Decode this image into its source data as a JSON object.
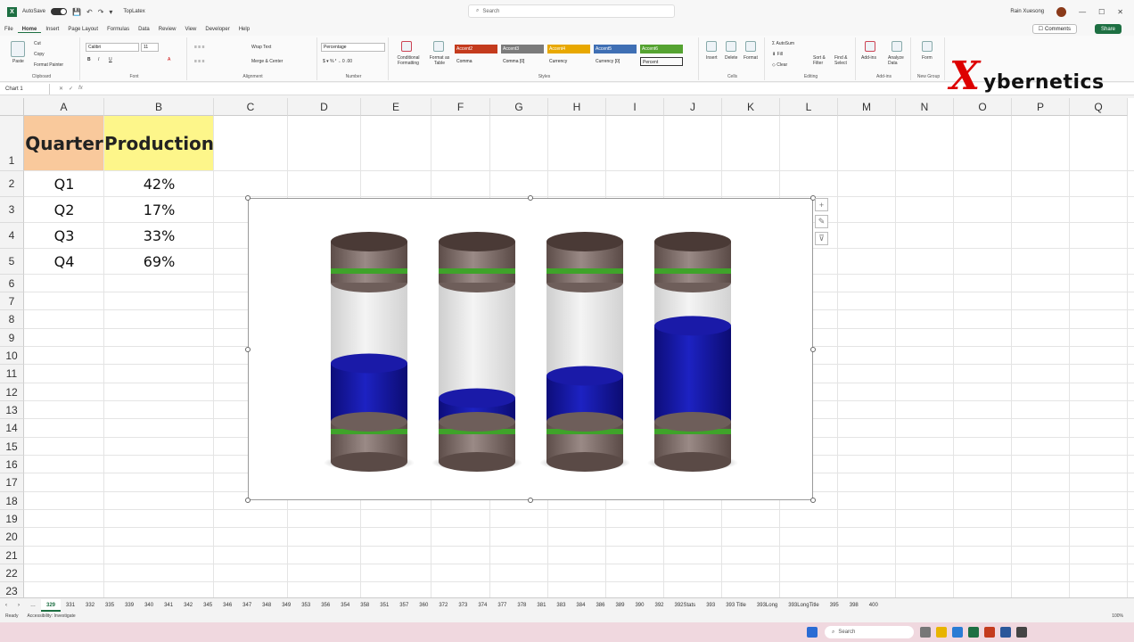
{
  "titlebar": {
    "autosave_label": "AutoSave",
    "file_name": "TopLatex",
    "search_placeholder": "Search",
    "user_name": "Rain Xuesong",
    "minimize": "—",
    "maximize": "☐",
    "close": "✕"
  },
  "menu": {
    "tabs": [
      "File",
      "Home",
      "Insert",
      "Page Layout",
      "Formulas",
      "Data",
      "Review",
      "View",
      "Developer",
      "Help"
    ],
    "active_tab": "Home",
    "comments_label": "Comments",
    "share_label": "Share"
  },
  "ribbon": {
    "clipboard": {
      "paste": "Paste",
      "cut": "Cut",
      "copy": "Copy",
      "format_painter": "Format Painter",
      "label": "Clipboard"
    },
    "font": {
      "font_name": "Calibri",
      "font_size": "11",
      "label": "Font"
    },
    "alignment": {
      "wrap_text": "Wrap Text",
      "merge_center": "Merge & Center",
      "label": "Alignment"
    },
    "number": {
      "format": "Percentage",
      "label": "Number"
    },
    "styles": {
      "conditional": "Conditional Formatting",
      "format_as_table": "Format as Table",
      "cells": [
        {
          "text": "Accent2",
          "color": "#c43b1d"
        },
        {
          "text": "Accent3",
          "color": "#7b7b7b"
        },
        {
          "text": "Accent4",
          "color": "#e8a800"
        },
        {
          "text": "Accent5",
          "color": "#3f6fb4"
        },
        {
          "text": "Accent6",
          "color": "#55a331"
        }
      ],
      "plain": [
        "Comma",
        "Comma [0]",
        "Currency",
        "Currency [0]",
        "Percent"
      ],
      "label": "Styles"
    },
    "cells": {
      "insert": "Insert",
      "delete": "Delete",
      "format": "Format",
      "label": "Cells"
    },
    "editing": {
      "autosum": "AutoSum",
      "fill": "Fill",
      "clear": "Clear",
      "sort_filter": "Sort & Filter",
      "find_select": "Find & Select",
      "label": "Editing"
    },
    "addins": {
      "addins": "Add-ins",
      "analyze": "Analyze Data",
      "label": "Add-ins"
    },
    "new_group": {
      "form": "Form",
      "label": "New Group"
    }
  },
  "formula_bar": {
    "name_box": "Chart 1",
    "fx": "fx",
    "content": ""
  },
  "columns": [
    "A",
    "B",
    "C",
    "D",
    "E",
    "F",
    "G",
    "H",
    "I",
    "J",
    "K",
    "L",
    "M",
    "N",
    "O",
    "P",
    "Q"
  ],
  "rows": [
    "1",
    "2",
    "3",
    "4",
    "5",
    "6",
    "7",
    "8",
    "9",
    "10",
    "11",
    "12",
    "13",
    "14",
    "15",
    "16",
    "17",
    "18",
    "19",
    "20",
    "21",
    "22",
    "23"
  ],
  "table": {
    "header_a": "Quarter",
    "header_b": "Production",
    "rows": [
      {
        "q": "Q1",
        "p": "42%"
      },
      {
        "q": "Q2",
        "p": "17%"
      },
      {
        "q": "Q3",
        "p": "33%"
      },
      {
        "q": "Q4",
        "p": "69%"
      }
    ]
  },
  "chart_data": {
    "type": "bar",
    "categories": [
      "Q1",
      "Q2",
      "Q3",
      "Q4"
    ],
    "values": [
      0.42,
      0.17,
      0.33,
      0.69
    ],
    "ylim": [
      0,
      1
    ],
    "colors": {
      "fill": "#1414a8",
      "glass": "#e8e8e8",
      "cap": "#7a6a66",
      "band": "#3fa32a"
    }
  },
  "logo": {
    "letter": "X",
    "text": "ybernetics"
  },
  "sheet_tabs": [
    "329",
    "331",
    "332",
    "335",
    "339",
    "340",
    "341",
    "342",
    "345",
    "346",
    "347",
    "348",
    "349",
    "353",
    "356",
    "354",
    "358",
    "351",
    "357",
    "360",
    "372",
    "373",
    "374",
    "377",
    "378",
    "381",
    "383",
    "384",
    "386",
    "389",
    "390",
    "392",
    "392Stats",
    "393",
    "393 Title",
    "393Long",
    "393LongTitle",
    "395",
    "398",
    "400"
  ],
  "active_sheet": "329",
  "status": {
    "ready": "Ready",
    "accessibility": "Accessibility: Investigate",
    "zoom": "100%"
  },
  "taskbar": {
    "search": "Search"
  }
}
